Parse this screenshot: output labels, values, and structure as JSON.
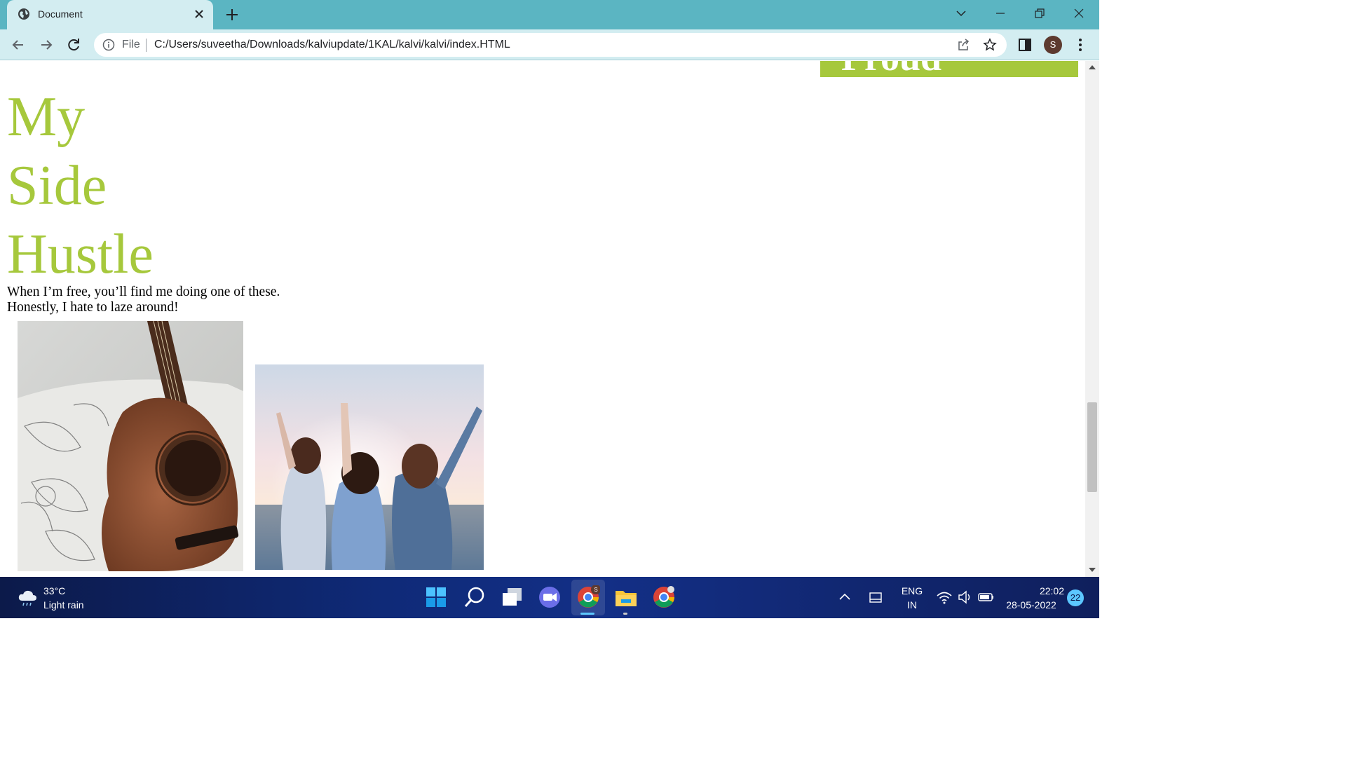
{
  "browser": {
    "tab_title": "Document",
    "address_scheme": "File",
    "url": "C:/Users/suveetha/Downloads/kalviupdate/1KAL/kalvi/kalvi/index.HTML",
    "profile_initial": "S"
  },
  "page": {
    "banner_text": "Proud",
    "heading_lines": [
      "My",
      "Side",
      "Hustle"
    ],
    "intro_line1": "When I’m free, you’ll find me doing one of these.",
    "intro_line2": "Honestly, I hate to laze around!",
    "images": [
      "guitar-photo",
      "friends-sunset-photo"
    ],
    "accent_color": "#a6c83c"
  },
  "taskbar": {
    "weather_temp": "33°C",
    "weather_condition": "Light rain",
    "language_line1": "ENG",
    "language_line2": "IN",
    "time": "22:02",
    "date": "28-05-2022",
    "notification_count": "22",
    "chrome_badge": "S"
  },
  "colors": {
    "tabstrip": "#5bb5c2",
    "toolbar": "#d3edf1",
    "taskbar": "#0f2a78"
  }
}
